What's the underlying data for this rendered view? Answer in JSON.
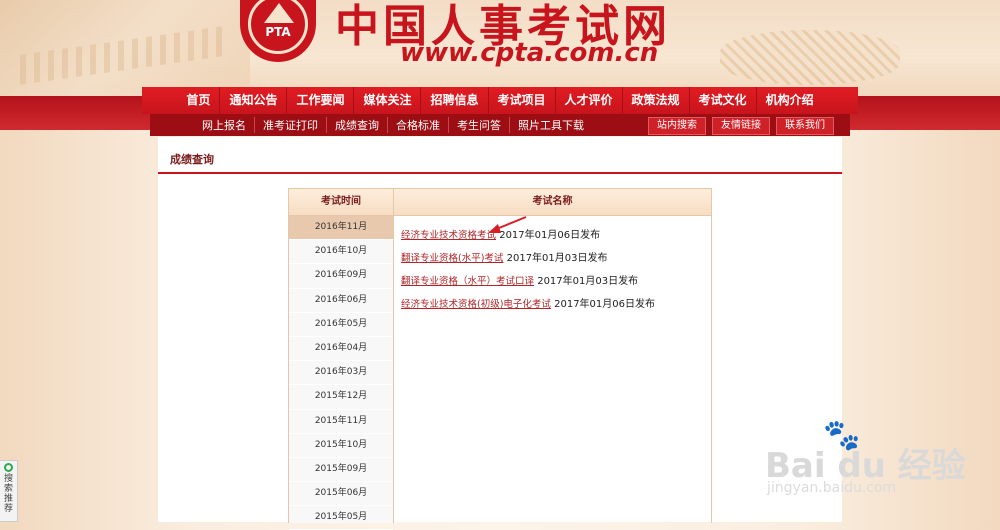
{
  "header": {
    "logo_text": "PTA",
    "site_title": "中国人事考试网",
    "site_url": "www.cpta.com.cn"
  },
  "nav": {
    "items": [
      "首页",
      "通知公告",
      "工作要闻",
      "媒体关注",
      "招聘信息",
      "考试项目",
      "人才评价",
      "政策法规",
      "考试文化",
      "机构介绍"
    ]
  },
  "subnav": {
    "items": [
      "网上报名",
      "准考证打印",
      "成绩查询",
      "合格标准",
      "考生问答",
      "照片工具下载"
    ],
    "buttons": [
      "站内搜索",
      "友情链接",
      "联系我们"
    ]
  },
  "section": {
    "title": "成绩查询"
  },
  "table": {
    "headers": {
      "time": "考试时间",
      "name": "考试名称"
    },
    "times": [
      "2016年11月",
      "2016年10月",
      "2016年09月",
      "2016年06月",
      "2016年05月",
      "2016年04月",
      "2016年03月",
      "2015年12月",
      "2015年11月",
      "2015年10月",
      "2015年09月",
      "2015年06月",
      "2015年05月"
    ],
    "active_index": 0,
    "exams": [
      {
        "name": "经济专业技术资格考试",
        "date": "2017年01月06日发布"
      },
      {
        "name": "翻译专业资格(水平)考试",
        "date": "2017年01月03日发布"
      },
      {
        "name": "翻译专业资格（水平）考试口译",
        "date": "2017年01月03日发布"
      },
      {
        "name": "经济专业技术资格(初级)电子化考试",
        "date": "2017年01月06日发布"
      }
    ]
  },
  "side_widget": {
    "text": "搜索推荐"
  },
  "watermark": {
    "main": "Bai du 经验",
    "sub": "jingyan.baidu.com"
  },
  "colors": {
    "primary_red": "#c8141c",
    "link": "#b0262a",
    "active_row": "#e9c9ae"
  }
}
